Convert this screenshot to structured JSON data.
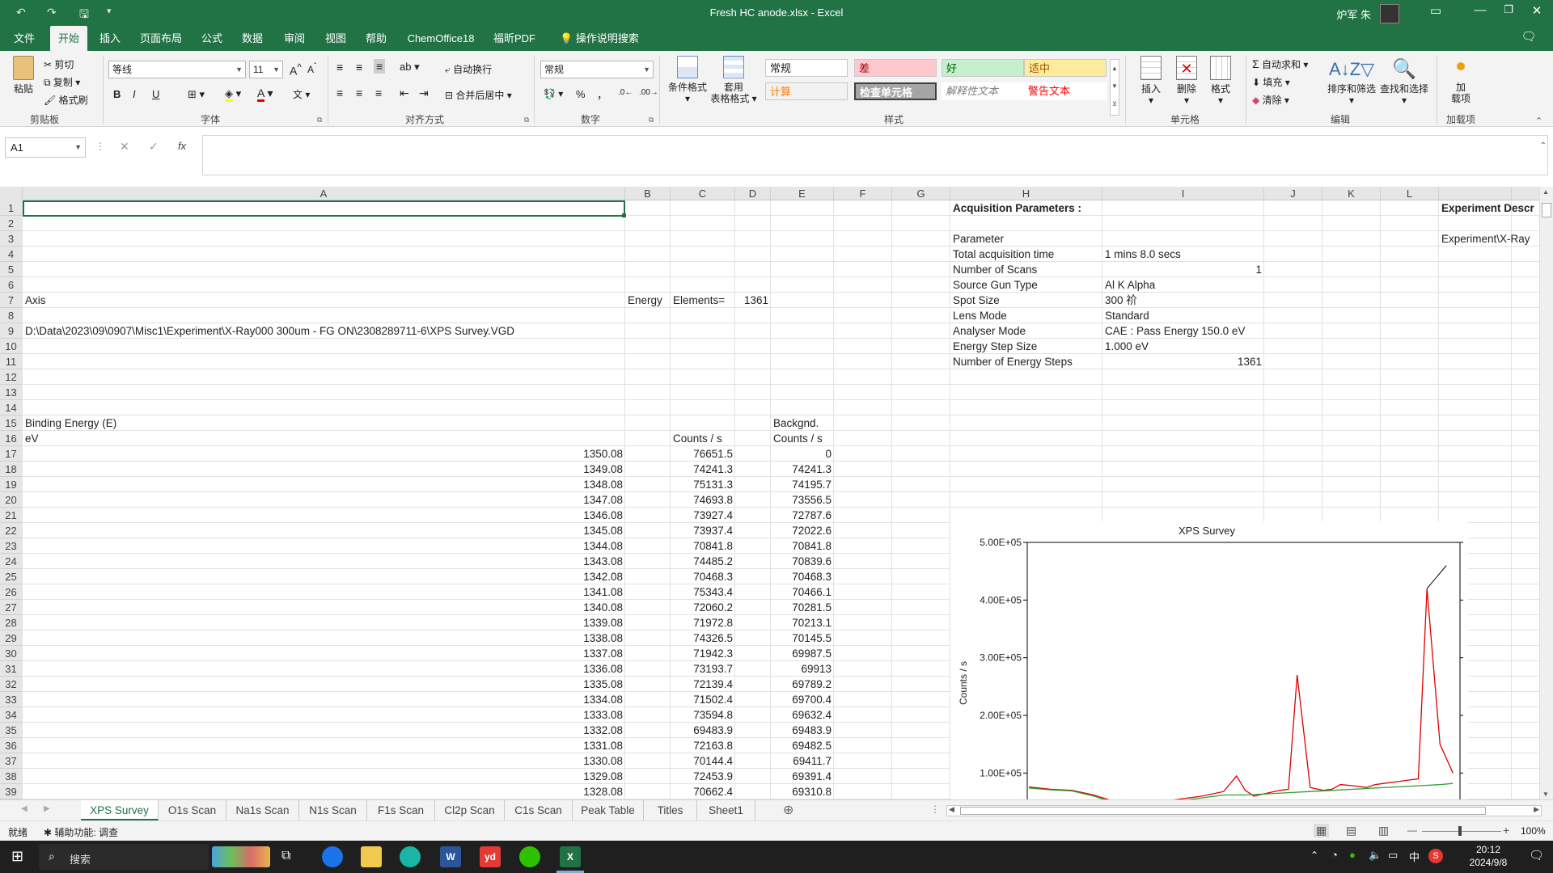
{
  "window": {
    "title": "Fresh HC anode.xlsx  -  Excel",
    "user": "炉军 朱"
  },
  "ribbon_tabs": [
    "文件",
    "开始",
    "插入",
    "页面布局",
    "公式",
    "数据",
    "审阅",
    "视图",
    "帮助",
    "ChemOffice18",
    "福昕PDF"
  ],
  "tell_me": "操作说明搜索",
  "ribbon": {
    "clipboard": {
      "paste": "粘贴",
      "cut": "剪切",
      "copy": "复制",
      "format_painter": "格式刷",
      "label": "剪贴板"
    },
    "font": {
      "name": "等线",
      "size": "11",
      "label": "字体",
      "bold": "B",
      "italic": "I",
      "underline": "U"
    },
    "alignment": {
      "wrap": "自动换行",
      "merge": "合并后居中",
      "label": "对齐方式"
    },
    "number": {
      "format": "常规",
      "percent": "%",
      "comma": "，",
      "label": "数字"
    },
    "styles": {
      "conditional": "条件格式",
      "table_format_1": "套用",
      "table_format_2": "表格格式",
      "cells": [
        {
          "text": "常规",
          "bg": "#ffffff",
          "color": "#222222"
        },
        {
          "text": "差",
          "bg": "#ffc7ce",
          "color": "#9c0006"
        },
        {
          "text": "好",
          "bg": "#c6efce",
          "color": "#006100"
        },
        {
          "text": "适中",
          "bg": "#ffeb9c",
          "color": "#9c5700"
        },
        {
          "text": "计算",
          "bg": "#f2f2f2",
          "color": "#fa7d00"
        },
        {
          "text": "检查单元格",
          "bg": "#a5a5a5",
          "color": "#ffffff"
        },
        {
          "text": "解释性文本",
          "bg": "#ffffff",
          "color": "#7f7f7f"
        },
        {
          "text": "警告文本",
          "bg": "#ffffff",
          "color": "#ff0000"
        }
      ],
      "label": "样式"
    },
    "cells_group": {
      "insert": "插入",
      "delete": "删除",
      "format": "格式",
      "label": "单元格"
    },
    "editing": {
      "autosum": "自动求和",
      "fill": "填充",
      "clear": "清除",
      "sort": "排序和筛选",
      "find": "查找和选择",
      "label": "编辑"
    },
    "addins": {
      "label1": "加",
      "label2": "载项",
      "label": "加载项"
    }
  },
  "formula_bar": {
    "name_box": "A1",
    "cancel": "✕",
    "enter": "✓",
    "fx": "fx",
    "content": ""
  },
  "columns": [
    "A",
    "B",
    "C",
    "D",
    "E",
    "F",
    "G",
    "H",
    "I",
    "J",
    "K",
    "L"
  ],
  "rows": [
    "1",
    "2",
    "3",
    "4",
    "5",
    "6",
    "7",
    "8",
    "9",
    "10",
    "11",
    "12",
    "13",
    "14",
    "15",
    "16",
    "17",
    "18",
    "19",
    "20",
    "21",
    "22",
    "23",
    "24",
    "25",
    "26",
    "27",
    "28",
    "29",
    "30",
    "31",
    "32",
    "33",
    "34",
    "35",
    "36",
    "37",
    "38",
    "39"
  ],
  "cells": {
    "a7": "Axis",
    "b7": "Energy",
    "c7": "Elements=",
    "d7": "1361",
    "a9": "D:\\Data\\2023\\09\\0907\\Misc1\\Experiment\\X-Ray000 300um - FG  ON\\2308289711-6\\XPS Survey.VGD",
    "a15": "Binding Energy (E)",
    "e15": "Backgnd.",
    "a16": "eV",
    "c16": "Counts / s",
    "e16": "Counts / s"
  },
  "data_rows": [
    [
      "1350.08",
      "76651.5",
      "0"
    ],
    [
      "1349.08",
      "74241.3",
      "74241.3"
    ],
    [
      "1348.08",
      "75131.3",
      "74195.7"
    ],
    [
      "1347.08",
      "74693.8",
      "73556.5"
    ],
    [
      "1346.08",
      "73927.4",
      "72787.6"
    ],
    [
      "1345.08",
      "73937.4",
      "72022.6"
    ],
    [
      "1344.08",
      "70841.8",
      "70841.8"
    ],
    [
      "1343.08",
      "74485.2",
      "70839.6"
    ],
    [
      "1342.08",
      "70468.3",
      "70468.3"
    ],
    [
      "1341.08",
      "75343.4",
      "70466.1"
    ],
    [
      "1340.08",
      "72060.2",
      "70281.5"
    ],
    [
      "1339.08",
      "71972.8",
      "70213.1"
    ],
    [
      "1338.08",
      "74326.5",
      "70145.5"
    ],
    [
      "1337.08",
      "71942.3",
      "69987.5"
    ],
    [
      "1336.08",
      "73193.7",
      "69913"
    ],
    [
      "1335.08",
      "72139.4",
      "69789.2"
    ],
    [
      "1334.08",
      "71502.4",
      "69700.4"
    ],
    [
      "1333.08",
      "73594.8",
      "69632.4"
    ],
    [
      "1332.08",
      "69483.9",
      "69483.9"
    ],
    [
      "1331.08",
      "72163.8",
      "69482.5"
    ],
    [
      "1330.08",
      "70144.4",
      "69411.7"
    ],
    [
      "1329.08",
      "72453.9",
      "69391.4"
    ],
    [
      "1328.08",
      "70662.4",
      "69310.8"
    ]
  ],
  "acquisition": {
    "title": "Acquisition Parameters :",
    "params": [
      [
        "Parameter",
        ""
      ],
      [
        "Total acquisition time",
        "1 mins 8.0 secs"
      ],
      [
        "Number of Scans",
        "1"
      ],
      [
        "Source Gun Type",
        "Al K Alpha"
      ],
      [
        "Spot Size",
        "300 祄"
      ],
      [
        "Lens Mode",
        "Standard"
      ],
      [
        "Analyser Mode",
        "CAE : Pass Energy 150.0 eV"
      ],
      [
        "Energy Step Size",
        "1.000 eV"
      ],
      [
        "Number of Energy Steps",
        "1361"
      ]
    ]
  },
  "experiment": {
    "title": "Experiment Descr",
    "value": "Experiment\\X-Ray"
  },
  "chart_data": {
    "type": "line",
    "title": "XPS Survey",
    "ylabel": "Counts / s",
    "yticks": [
      "5.00E+05",
      "4.00E+05",
      "3.00E+05",
      "2.00E+05",
      "1.00E+05"
    ],
    "ylim": [
      0,
      500000
    ],
    "series": [
      {
        "color": "#e00000",
        "x": [
          0,
          5,
          10,
          15,
          20,
          25,
          28,
          30,
          35,
          40,
          45,
          48,
          50,
          52,
          55,
          58,
          60,
          62,
          65,
          68,
          70,
          72,
          75,
          78,
          80,
          82,
          85,
          88,
          90,
          92,
          95,
          98
        ],
        "y": [
          76000,
          72000,
          70000,
          62000,
          50000,
          45000,
          46000,
          50000,
          55000,
          60000,
          68000,
          95000,
          70000,
          60000,
          65000,
          70000,
          72000,
          270000,
          75000,
          70000,
          72000,
          80000,
          78000,
          75000,
          80000,
          82000,
          85000,
          88000,
          90000,
          420000,
          150000,
          100000
        ]
      },
      {
        "color": "#2ca02c",
        "x": [
          0,
          5,
          10,
          15,
          20,
          25,
          30,
          35,
          40,
          45,
          50,
          55,
          60,
          65,
          70,
          75,
          80,
          85,
          90,
          95,
          98
        ],
        "y": [
          74000,
          71000,
          69000,
          60000,
          48000,
          44000,
          48000,
          52000,
          57000,
          62000,
          62000,
          64000,
          66000,
          68000,
          70000,
          72000,
          74000,
          76000,
          78000,
          80000,
          82000
        ]
      }
    ]
  },
  "sheet_tabs": [
    "XPS Survey",
    "O1s Scan",
    "Na1s Scan",
    "N1s Scan",
    "F1s Scan",
    "Cl2p Scan",
    "C1s Scan",
    "Peak Table",
    "Titles",
    "Sheet1"
  ],
  "status": {
    "ready": "就绪",
    "accessibility": "辅助功能: 调查",
    "zoom": "100%"
  },
  "taskbar": {
    "search": "搜索",
    "time": "20:12",
    "date": "2024/9/8",
    "ime": "中"
  }
}
